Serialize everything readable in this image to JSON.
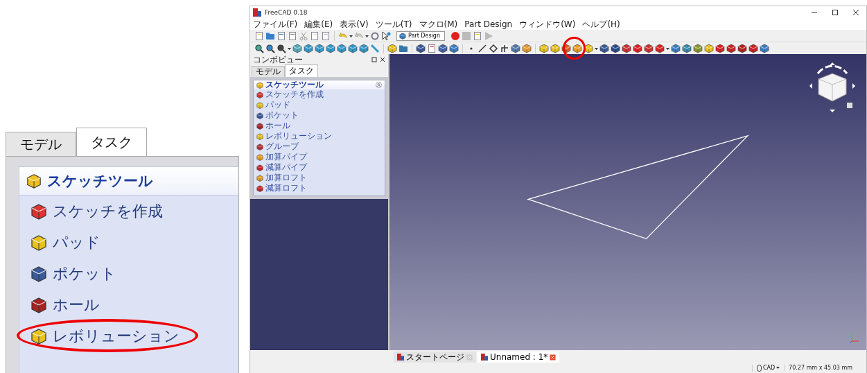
{
  "inset": {
    "tabs": [
      {
        "label": "モデル",
        "selected": false
      },
      {
        "label": "タスク",
        "selected": true
      }
    ],
    "panel": {
      "title": "スケッチツール",
      "items": [
        {
          "label": "スケッチを作成",
          "kind": "sketch",
          "circled": false
        },
        {
          "label": "パッド",
          "kind": "pad",
          "circled": false
        },
        {
          "label": "ポケット",
          "kind": "pocket",
          "circled": false
        },
        {
          "label": "ホール",
          "kind": "hole",
          "circled": false
        },
        {
          "label": "レボリューション",
          "kind": "revolution",
          "circled": true
        }
      ]
    }
  },
  "window": {
    "title": "FreeCAD 0.18",
    "menu": [
      "ファイル(F)",
      "編集(E)",
      "表示(V)",
      "ツール(T)",
      "マクロ(M)",
      "Part Design",
      "ウィンドウ(W)",
      "ヘルプ(H)"
    ],
    "workbench": "Part Design",
    "toolbar_circle": true,
    "combo": {
      "title": "コンボビュー",
      "tabs": [
        {
          "label": "モデル",
          "selected": false
        },
        {
          "label": "タスク",
          "selected": true
        }
      ],
      "panel_title": "スケッチツール",
      "items": [
        {
          "label": "スケッチを作成",
          "kind": "sketch"
        },
        {
          "label": "パッド",
          "kind": "pad"
        },
        {
          "label": "ポケット",
          "kind": "pocket"
        },
        {
          "label": "ホール",
          "kind": "hole"
        },
        {
          "label": "レボリューション",
          "kind": "revolution"
        },
        {
          "label": "グルーブ",
          "kind": "groove"
        },
        {
          "label": "加算パイプ",
          "kind": "additive"
        },
        {
          "label": "減算パイプ",
          "kind": "subtractive"
        },
        {
          "label": "加算ロフト",
          "kind": "additive"
        },
        {
          "label": "減算ロフト",
          "kind": "subtractive"
        }
      ]
    },
    "doc_tabs": [
      {
        "label": "スタートページ",
        "selected": false
      },
      {
        "label": "Unnamed : 1*",
        "selected": true
      }
    ],
    "status": {
      "navigation": "CAD",
      "dimensions": "70.27 mm x 45.03 mm"
    }
  }
}
